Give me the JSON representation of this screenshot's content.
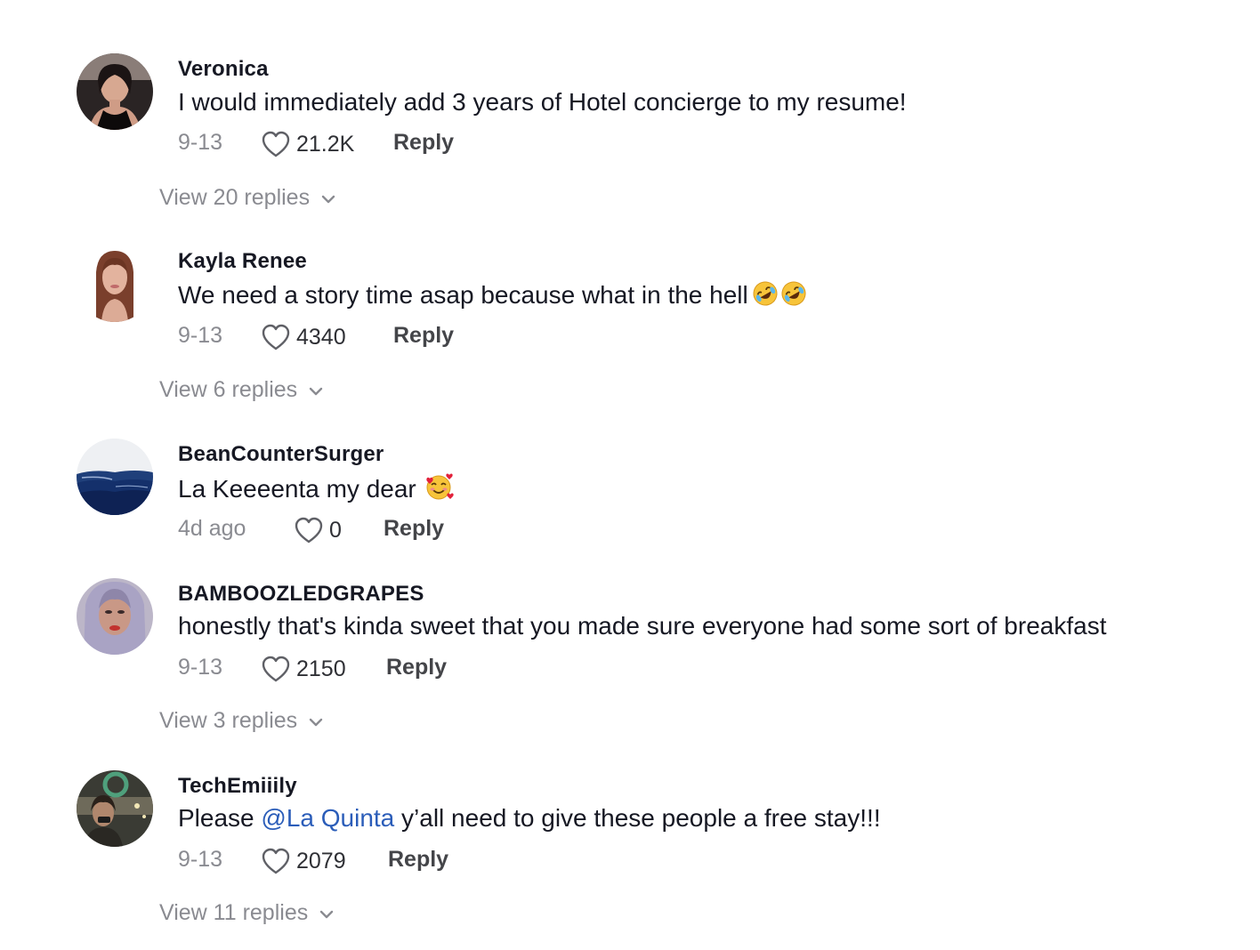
{
  "comments": [
    {
      "username": "Veronica",
      "text": "I would immediately add 3 years of Hotel concierge to my resume!",
      "date": "9-13",
      "likes": "21.2K",
      "reply_label": "Reply",
      "view_replies": "View 20 replies"
    },
    {
      "username": "Kayla Renee",
      "text": "We need a story time asap because what in the hell",
      "emoji": [
        "rolling-on-floor-laughing-emoji",
        "rolling-on-floor-laughing-emoji"
      ],
      "date": "9-13",
      "likes": "4340",
      "reply_label": "Reply",
      "view_replies": "View 6 replies"
    },
    {
      "username": "BeanCounterSurger",
      "text": "La Keeeenta my dear",
      "emoji": [
        "smiling-face-with-hearts-emoji"
      ],
      "date": "4d ago",
      "likes": "0",
      "reply_label": "Reply"
    },
    {
      "username": "BAMBOOZLEDGRAPES",
      "text": "honestly that's kinda sweet that you made sure everyone had some sort of breakfast",
      "date": "9-13",
      "likes": "2150",
      "reply_label": "Reply",
      "view_replies": "View 3 replies"
    },
    {
      "username": "TechEmiiily",
      "text_before": "Please ",
      "mention": "@La Quinta",
      "text_after": " y’all need to give these people a free stay!!!",
      "date": "9-13",
      "likes": "2079",
      "reply_label": "Reply",
      "view_replies": "View 11 replies"
    }
  ],
  "icons": {
    "like": "heart-outline-icon",
    "expand": "chevron-down-icon"
  },
  "colors": {
    "text": "#161823",
    "muted": "#8a8b91",
    "mention": "#2b5db9",
    "background": "#ffffff"
  }
}
